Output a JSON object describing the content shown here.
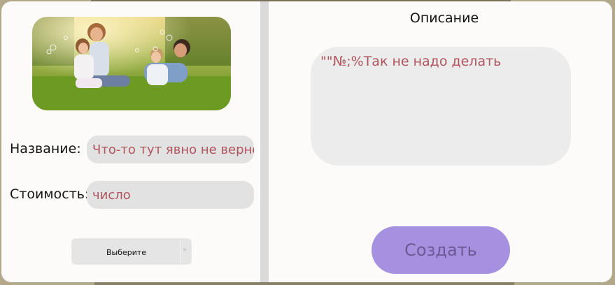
{
  "form": {
    "name_label": "Название:",
    "name_value": "Что-то тут явно не верно",
    "cost_label": "Стоимость:",
    "cost_value": "число",
    "category_select": "Выберите"
  },
  "description": {
    "title": "Описание",
    "value": "\"\"№;%Так не надо делать"
  },
  "actions": {
    "create_label": "Создать"
  },
  "colors": {
    "panel_bg": "#fcfbfa",
    "field_bg": "#e2e2e2",
    "error_text": "#b0545e",
    "create_button": "#a691e0"
  }
}
